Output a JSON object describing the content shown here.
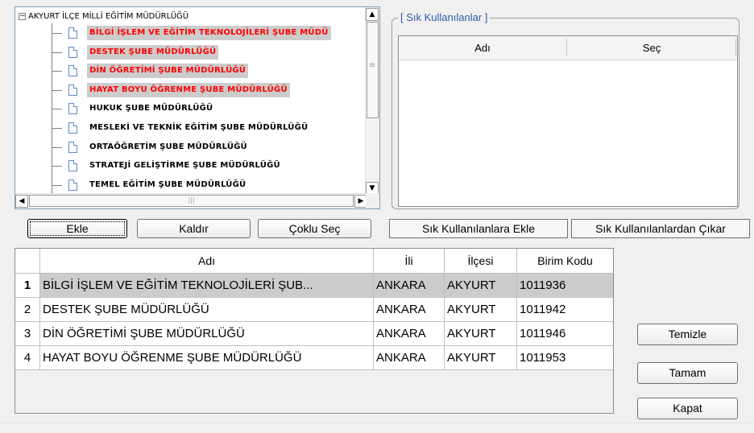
{
  "tree": {
    "root_label": "AKYURT İLÇE MİLLİ EĞİTİM MÜDÜRLÜĞÜ",
    "items": [
      {
        "label": "BİLGİ İŞLEM VE EĞİTİM TEKNOLOJİLERİ ŞUBE MÜDÜ",
        "selected": true
      },
      {
        "label": "DESTEK ŞUBE MÜDÜRLÜĞÜ",
        "selected": true
      },
      {
        "label": "DİN ÖĞRETİMİ ŞUBE MÜDÜRLÜĞÜ",
        "selected": true
      },
      {
        "label": "HAYAT BOYU ÖĞRENME ŞUBE MÜDÜRLÜĞÜ",
        "selected": true
      },
      {
        "label": "HUKUK ŞUBE MÜDÜRLÜĞÜ",
        "selected": false
      },
      {
        "label": "MESLEKİ VE TEKNİK EĞİTİM ŞUBE MÜDÜRLÜĞÜ",
        "selected": false
      },
      {
        "label": "ORTAÖĞRETİM ŞUBE MÜDÜRLÜĞÜ",
        "selected": false
      },
      {
        "label": "STRATEJİ GELİŞTİRME ŞUBE MÜDÜRLÜĞÜ",
        "selected": false
      },
      {
        "label": "TEMEL EĞİTİM ŞUBE MÜDÜRLÜĞÜ",
        "selected": false
      }
    ]
  },
  "favorites": {
    "title": "[ Sık Kullanılanlar ]",
    "col_name": "Adı",
    "col_select": "Seç"
  },
  "buttons": {
    "add": "Ekle",
    "remove": "Kaldır",
    "multi_select": "Çoklu Seç",
    "add_favorites": "Sık Kullanılanlara Ekle",
    "remove_favorites": "Sık Kullanılanlardan Çıkar",
    "clear": "Temizle",
    "ok": "Tamam",
    "close": "Kapat"
  },
  "grid": {
    "headers": [
      "Adı",
      "İli",
      "İlçesi",
      "Birim Kodu"
    ],
    "rows": [
      {
        "num": "1",
        "name": "BİLGİ İŞLEM VE EĞİTİM TEKNOLOJİLERİ ŞUB...",
        "il": "ANKARA",
        "ilce": "AKYURT",
        "code": "1011936",
        "selected": true
      },
      {
        "num": "2",
        "name": "DESTEK ŞUBE MÜDÜRLÜĞÜ",
        "il": "ANKARA",
        "ilce": "AKYURT",
        "code": "1011942",
        "selected": false
      },
      {
        "num": "3",
        "name": "DİN ÖĞRETİMİ ŞUBE MÜDÜRLÜĞÜ",
        "il": "ANKARA",
        "ilce": "AKYURT",
        "code": "1011946",
        "selected": false
      },
      {
        "num": "4",
        "name": "HAYAT BOYU ÖĞRENME ŞUBE MÜDÜRLÜĞÜ",
        "il": "ANKARA",
        "ilce": "AKYURT",
        "code": "1011953",
        "selected": false
      }
    ]
  },
  "colors": {
    "selection_text": "#ff0000",
    "selection_bg": "#cccccc",
    "group_title": "#2c5ea8"
  }
}
